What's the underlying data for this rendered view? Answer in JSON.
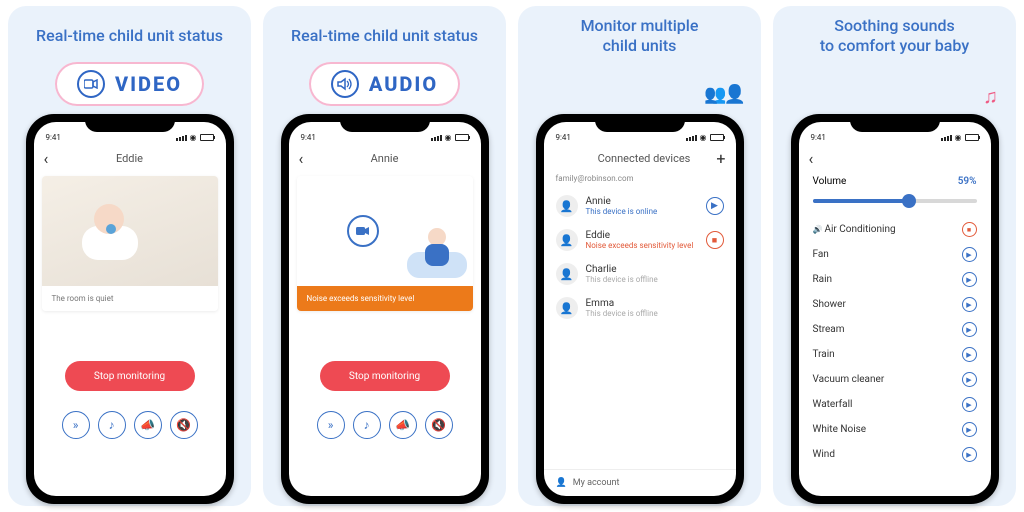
{
  "statusbar": {
    "time": "9:41"
  },
  "panel1": {
    "title": "Real-time child unit status",
    "pill_label": "VIDEO",
    "child_name": "Eddie",
    "caption": "The room is quiet",
    "stop_label": "Stop monitoring",
    "icons": [
      "fast-forward-icon",
      "music-note-icon",
      "megaphone-icon",
      "mute-icon"
    ]
  },
  "panel2": {
    "title": "Real-time child unit status",
    "pill_label": "AUDIO",
    "child_name": "Annie",
    "caption": "Noise exceeds sensitivity level",
    "stop_label": "Stop monitoring",
    "icons": [
      "fast-forward-icon",
      "music-note-icon",
      "megaphone-icon",
      "mute-icon"
    ]
  },
  "panel3": {
    "title": "Monitor multiple\nchild units",
    "header": "Connected devices",
    "account_email": "family@robinson.com",
    "devices": [
      {
        "name": "Annie",
        "status": "This device is online",
        "status_kind": "online",
        "action": "play"
      },
      {
        "name": "Eddie",
        "status": "Noise exceeds sensitivity level",
        "status_kind": "alert",
        "action": "rec"
      },
      {
        "name": "Charlie",
        "status": "This device is offline",
        "status_kind": "offline",
        "action": ""
      },
      {
        "name": "Emma",
        "status": "This device is offline",
        "status_kind": "offline",
        "action": ""
      }
    ],
    "footer": "My account"
  },
  "panel4": {
    "title": "Soothing sounds\nto comfort your baby",
    "volume_label": "Volume",
    "volume_pct": "59%",
    "volume_value": 59,
    "sounds": [
      {
        "name": "Air Conditioning",
        "state": "playing"
      },
      {
        "name": "Fan",
        "state": "idle"
      },
      {
        "name": "Rain",
        "state": "idle"
      },
      {
        "name": "Shower",
        "state": "idle"
      },
      {
        "name": "Stream",
        "state": "idle"
      },
      {
        "name": "Train",
        "state": "idle"
      },
      {
        "name": "Vacuum cleaner",
        "state": "idle"
      },
      {
        "name": "Waterfall",
        "state": "idle"
      },
      {
        "name": "White Noise",
        "state": "idle"
      },
      {
        "name": "Wind",
        "state": "idle"
      }
    ]
  },
  "colors": {
    "accent": "#3a71c5",
    "pink": "#ef5b84",
    "danger": "#ee4a53",
    "warn": "#ec7a1a"
  }
}
